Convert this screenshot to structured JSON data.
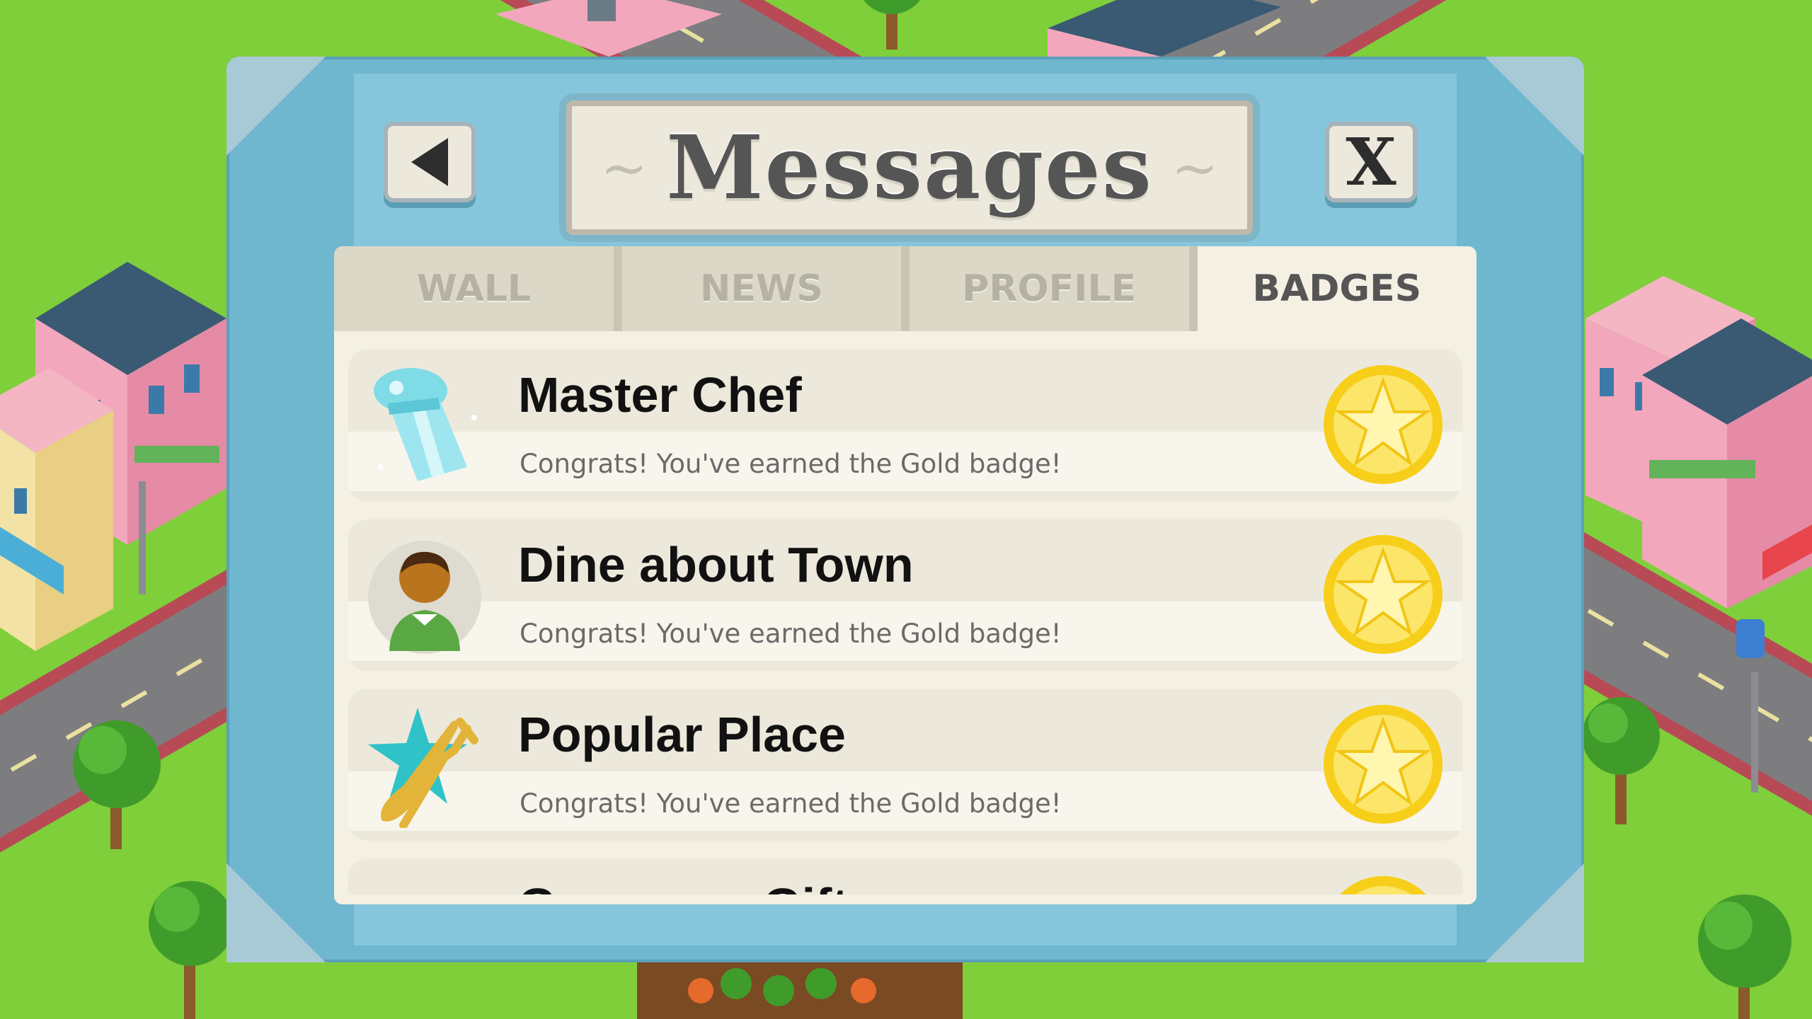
{
  "screen": {
    "title": "Messages",
    "back_button": "back",
    "close_label": "X"
  },
  "tabs": [
    {
      "label": "WALL",
      "active": false
    },
    {
      "label": "NEWS",
      "active": false
    },
    {
      "label": "PROFILE",
      "active": false
    },
    {
      "label": "BADGES",
      "active": true
    }
  ],
  "badges": [
    {
      "title": "Master Chef",
      "subtitle": "Congrats! You've earned the Gold badge!",
      "icon": "chef-hat-icon",
      "level": "gold"
    },
    {
      "title": "Dine about Town",
      "subtitle": "Congrats! You've earned the Gold badge!",
      "icon": "diner-avatar-icon",
      "level": "gold"
    },
    {
      "title": "Popular Place",
      "subtitle": "Congrats! You've earned the Gold badge!",
      "icon": "utensils-star-icon",
      "level": "gold"
    },
    {
      "title": "Generous Gift",
      "subtitle": "",
      "icon": "gift-icon",
      "level": "gold"
    }
  ],
  "colors": {
    "frame": "#6fb6cf",
    "panel": "#f4f1e4",
    "gold": "#f6d21c",
    "grass": "#7fcf3a"
  }
}
